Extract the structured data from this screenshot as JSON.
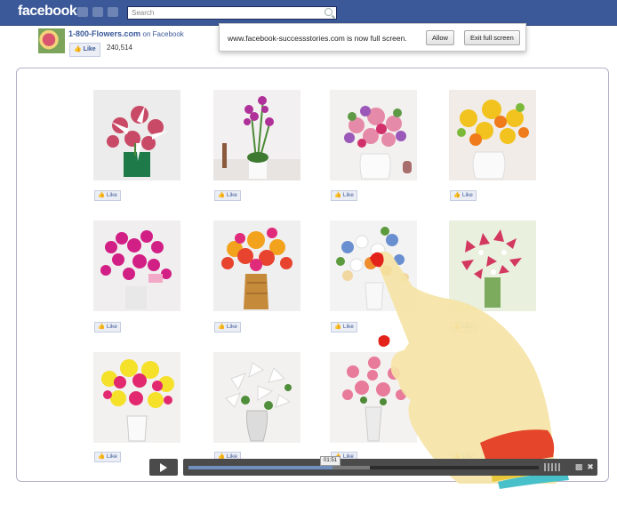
{
  "app": {
    "logo": "facebook"
  },
  "search": {
    "placeholder": "Search"
  },
  "page": {
    "name": "1-800-Flowers.com",
    "on_label": "on Facebook",
    "like_label": "Like",
    "like_count": "240,514"
  },
  "fullscreen_notice": {
    "message": "www.facebook-successstories.com is now full screen.",
    "allow_label": "Allow",
    "exit_label": "Exit full screen"
  },
  "grid": {
    "like_label": "Like"
  },
  "video": {
    "timestamp": "01:51",
    "progress": 0.41
  }
}
